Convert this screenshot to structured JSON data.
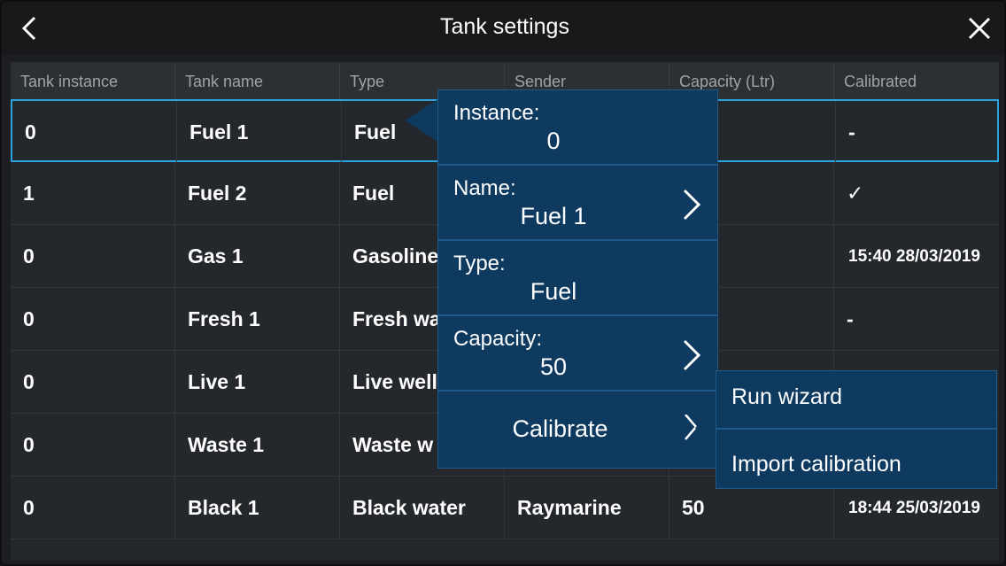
{
  "header": {
    "title": "Tank settings"
  },
  "table": {
    "columns": [
      "Tank instance",
      "Tank name",
      "Type",
      "Sender",
      "Capacity (Ltr)",
      "Calibrated"
    ],
    "rows": [
      [
        "0",
        "Fuel 1",
        "Fuel",
        "",
        "",
        "-"
      ],
      [
        "1",
        "Fuel 2",
        "Fuel",
        "",
        "",
        "✓"
      ],
      [
        "0",
        "Gas 1",
        "Gasoline",
        "",
        "",
        "15:40 28/03/2019"
      ],
      [
        "0",
        "Fresh 1",
        "Fresh wa",
        "",
        "",
        "-"
      ],
      [
        "0",
        "Live 1",
        "Live well",
        "",
        "",
        ""
      ],
      [
        "0",
        "Waste 1",
        "Waste w",
        "",
        "",
        ""
      ],
      [
        "0",
        "Black 1",
        "Black water",
        "Raymarine",
        "50",
        "18:44 25/03/2019"
      ]
    ],
    "selected_row": 0
  },
  "popup": {
    "instance": {
      "label": "Instance:",
      "value": "0"
    },
    "name": {
      "label": "Name:",
      "value": "Fuel 1"
    },
    "type": {
      "label": "Type:",
      "value": "Fuel"
    },
    "capacity": {
      "label": "Capacity:",
      "value": "50"
    },
    "calibrate": {
      "label": "Calibrate"
    }
  },
  "submenu": {
    "run_wizard": "Run wizard",
    "import_calibration": "Import calibration"
  },
  "colors": {
    "background": "#1c1e21",
    "selection_border": "#2aa4de",
    "popup_bg": "#0e3a60",
    "header_text": "#9ea3a8"
  },
  "icons": {
    "back": "chevron-left-icon",
    "close": "close-icon",
    "chevron": "chevron-right-icon"
  }
}
